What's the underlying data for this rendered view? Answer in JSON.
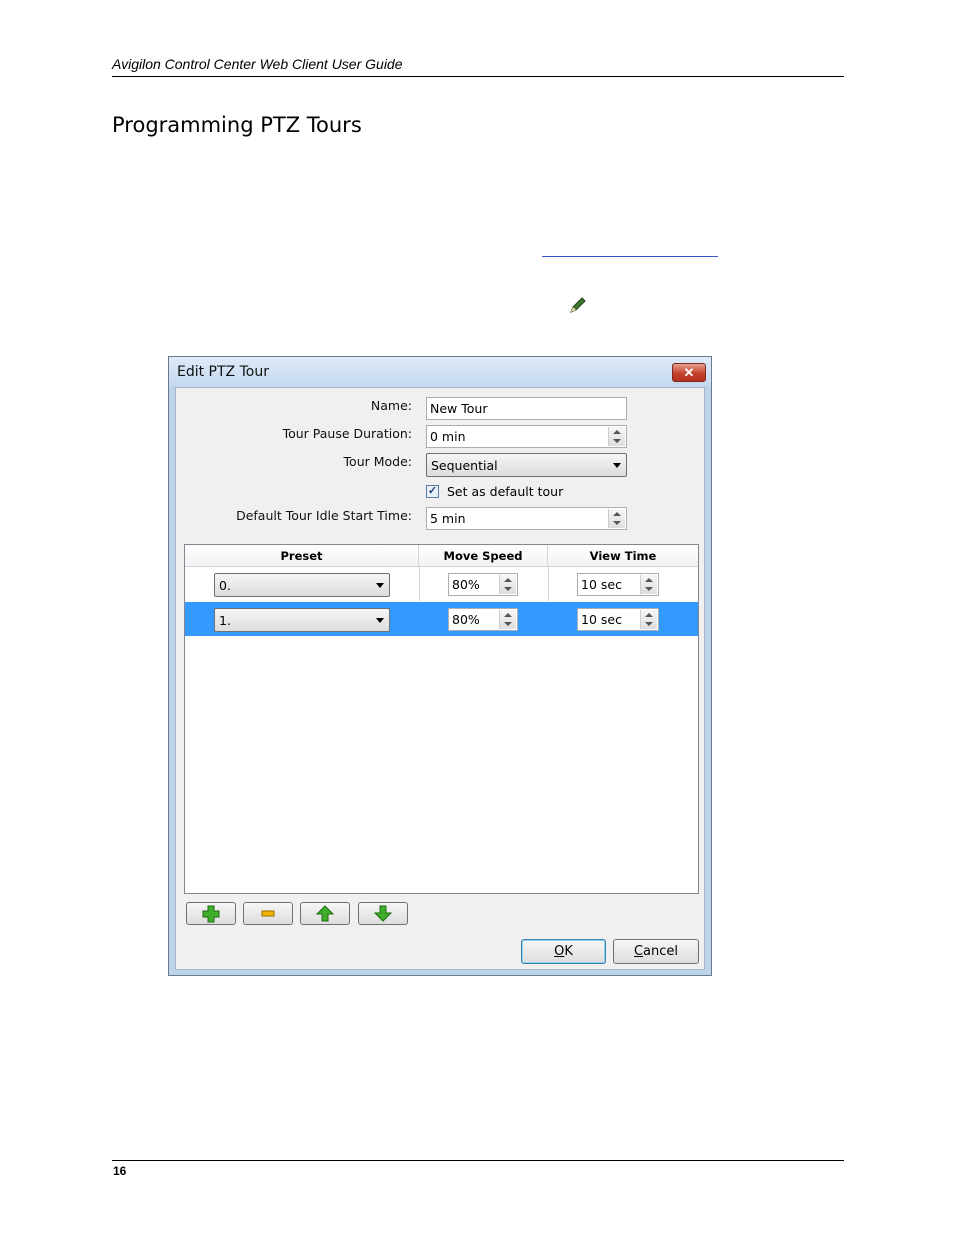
{
  "document": {
    "header": "Avigilon Control Center Web Client User Guide",
    "title": "Programming PTZ Tours",
    "page_number": "16"
  },
  "dialog": {
    "title": "Edit PTZ Tour",
    "close_glyph": "✕",
    "fields": {
      "name_label": "Name:",
      "name_value": "New Tour",
      "pause_label": "Tour Pause Duration:",
      "pause_value": "0 min",
      "mode_label": "Tour Mode:",
      "mode_value": "Sequential",
      "default_checkbox_label": "Set as default tour",
      "default_checked": true,
      "idle_label": "Default Tour Idle Start Time:",
      "idle_value": "5 min"
    },
    "table": {
      "columns": [
        "Preset",
        "Move Speed",
        "View Time"
      ],
      "rows": [
        {
          "preset": "0.",
          "speed": "80%",
          "time": "10 sec",
          "selected": false
        },
        {
          "preset": "1.",
          "speed": "80%",
          "time": "10 sec",
          "selected": true
        }
      ]
    },
    "toolbar_icons": [
      "add-icon",
      "remove-icon",
      "move-up-icon",
      "move-down-icon"
    ],
    "buttons": {
      "ok_prefix": "O",
      "ok_accel": "",
      "ok_rest": "K",
      "cancel_accel": "C",
      "cancel_rest": "ancel"
    },
    "colors": {
      "selection": "#3399ff",
      "add_icon": "#3fae2a",
      "remove_icon": "#f0b400",
      "arrow_icon": "#3fae2a"
    }
  }
}
